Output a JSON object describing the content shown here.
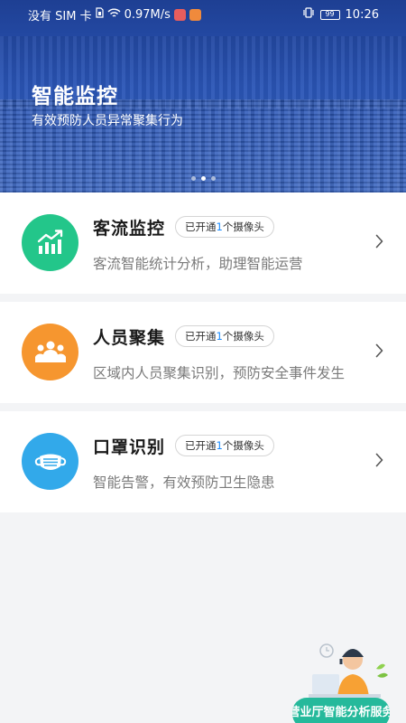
{
  "status_bar": {
    "carrier": "没有 SIM 卡",
    "speed": "0.97M/s",
    "battery": "99",
    "time": "10:26"
  },
  "banner": {
    "title": "智能监控",
    "subtitle": "有效预防人员异常聚集行为",
    "slide_count": 3,
    "active_slide": 2
  },
  "features": [
    {
      "title": "客流监控",
      "badge_prefix": "已开通",
      "badge_count": "1",
      "badge_suffix": "个摄像头",
      "description": "客流智能统计分析，助理智能运营",
      "icon": "chart-growth-icon",
      "color": "#23c68a"
    },
    {
      "title": "人员聚集",
      "badge_prefix": "已开通",
      "badge_count": "1",
      "badge_suffix": "个摄像头",
      "description": "区域内人员聚集识别，预防安全事件发生",
      "icon": "people-group-icon",
      "color": "#f6962f"
    },
    {
      "title": "口罩识别",
      "badge_prefix": "已开通",
      "badge_count": "1",
      "badge_suffix": "个摄像头",
      "description": "智能告警，有效预防卫生隐患",
      "icon": "face-mask-icon",
      "color": "#32a9ea"
    }
  ],
  "service_widget": {
    "label": "营业厅智能分析服务",
    "color": "#25b99b"
  }
}
